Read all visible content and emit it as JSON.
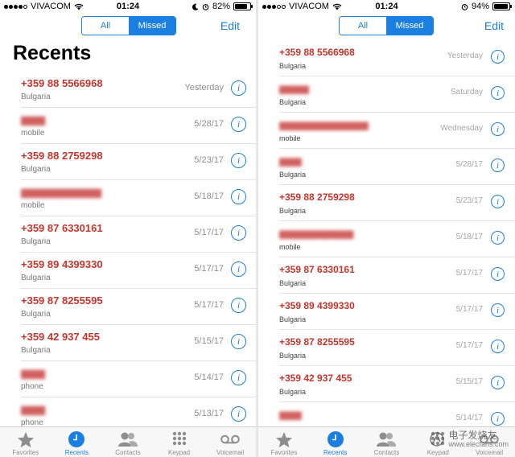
{
  "left": {
    "status": {
      "carrier": "VIVACOM",
      "time": "01:24",
      "battery": "82%",
      "battery_level": 0.82
    },
    "segment": {
      "all": "All",
      "missed": "Missed"
    },
    "edit": "Edit",
    "title": "Recents",
    "calls": [
      {
        "name": "+359 88 5566968",
        "sub": "Bulgaria",
        "date": "Yesterday",
        "blurred": false
      },
      {
        "name": "▆▆▆",
        "sub": "mobile",
        "date": "5/28/17",
        "blurred": true
      },
      {
        "name": "+359 88 2759298",
        "sub": "Bulgaria",
        "date": "5/23/17",
        "blurred": false
      },
      {
        "name": "▆▆▆▆▆▆▆▆▆▆",
        "sub": "mobile",
        "date": "5/18/17",
        "blurred": true
      },
      {
        "name": "+359 87 6330161",
        "sub": "Bulgaria",
        "date": "5/17/17",
        "blurred": false
      },
      {
        "name": "+359 89 4399330",
        "sub": "Bulgaria",
        "date": "5/17/17",
        "blurred": false
      },
      {
        "name": "+359 87 8255595",
        "sub": "Bulgaria",
        "date": "5/17/17",
        "blurred": false
      },
      {
        "name": "+359 42 937 455",
        "sub": "Bulgaria",
        "date": "5/15/17",
        "blurred": false
      },
      {
        "name": "▆▆▆",
        "sub": "phone",
        "date": "5/14/17",
        "blurred": true
      },
      {
        "name": "▆▆▆",
        "sub": "phone",
        "date": "5/13/17",
        "blurred": true
      }
    ],
    "tabs": [
      "Favorites",
      "Recents",
      "Contacts",
      "Keypad",
      "Voicemail"
    ]
  },
  "right": {
    "status": {
      "carrier": "VIVACOM",
      "time": "01:24",
      "battery": "94%",
      "battery_level": 0.94
    },
    "segment": {
      "all": "All",
      "missed": "Missed"
    },
    "edit": "Edit",
    "calls": [
      {
        "name": "+359 88 5566968",
        "sub": "Bulgaria",
        "date": "Yesterday",
        "blurred": false
      },
      {
        "name": "▆▆▆▆",
        "sub": "Bulgaria",
        "date": "Saturday",
        "blurred": true
      },
      {
        "name": "▆▆▆▆▆▆▆▆▆▆▆▆",
        "sub": "mobile",
        "date": "Wednesday",
        "blurred": true
      },
      {
        "name": "▆▆▆",
        "sub": "Bulgaria",
        "date": "5/28/17",
        "blurred": true
      },
      {
        "name": "+359 88 2759298",
        "sub": "Bulgaria",
        "date": "5/23/17",
        "blurred": false
      },
      {
        "name": "▆▆▆▆▆▆▆▆▆▆",
        "sub": "mobile",
        "date": "5/18/17",
        "blurred": true
      },
      {
        "name": "+359 87 6330161",
        "sub": "Bulgaria",
        "date": "5/17/17",
        "blurred": false
      },
      {
        "name": "+359 89 4399330",
        "sub": "Bulgaria",
        "date": "5/17/17",
        "blurred": false
      },
      {
        "name": "+359 87 8255595",
        "sub": "Bulgaria",
        "date": "5/17/17",
        "blurred": false
      },
      {
        "name": "+359 42 937 455",
        "sub": "Bulgaria",
        "date": "5/15/17",
        "blurred": false
      },
      {
        "name": "▆▆▆",
        "sub": "",
        "date": "5/14/17",
        "blurred": true
      }
    ],
    "tabs": [
      "Favorites",
      "Recents",
      "Contacts",
      "Keypad",
      "Voicemail"
    ]
  },
  "watermark": {
    "line1": "电子发烧友",
    "line2": "www.elecfans.com"
  },
  "colors": {
    "accent": "#1a7fe0",
    "missed": "#c4362d"
  },
  "icons": [
    "star-icon",
    "clock-icon",
    "contacts-icon",
    "keypad-icon",
    "voicemail-icon",
    "info-icon",
    "wifi-icon",
    "moon-icon",
    "alarm-icon"
  ]
}
